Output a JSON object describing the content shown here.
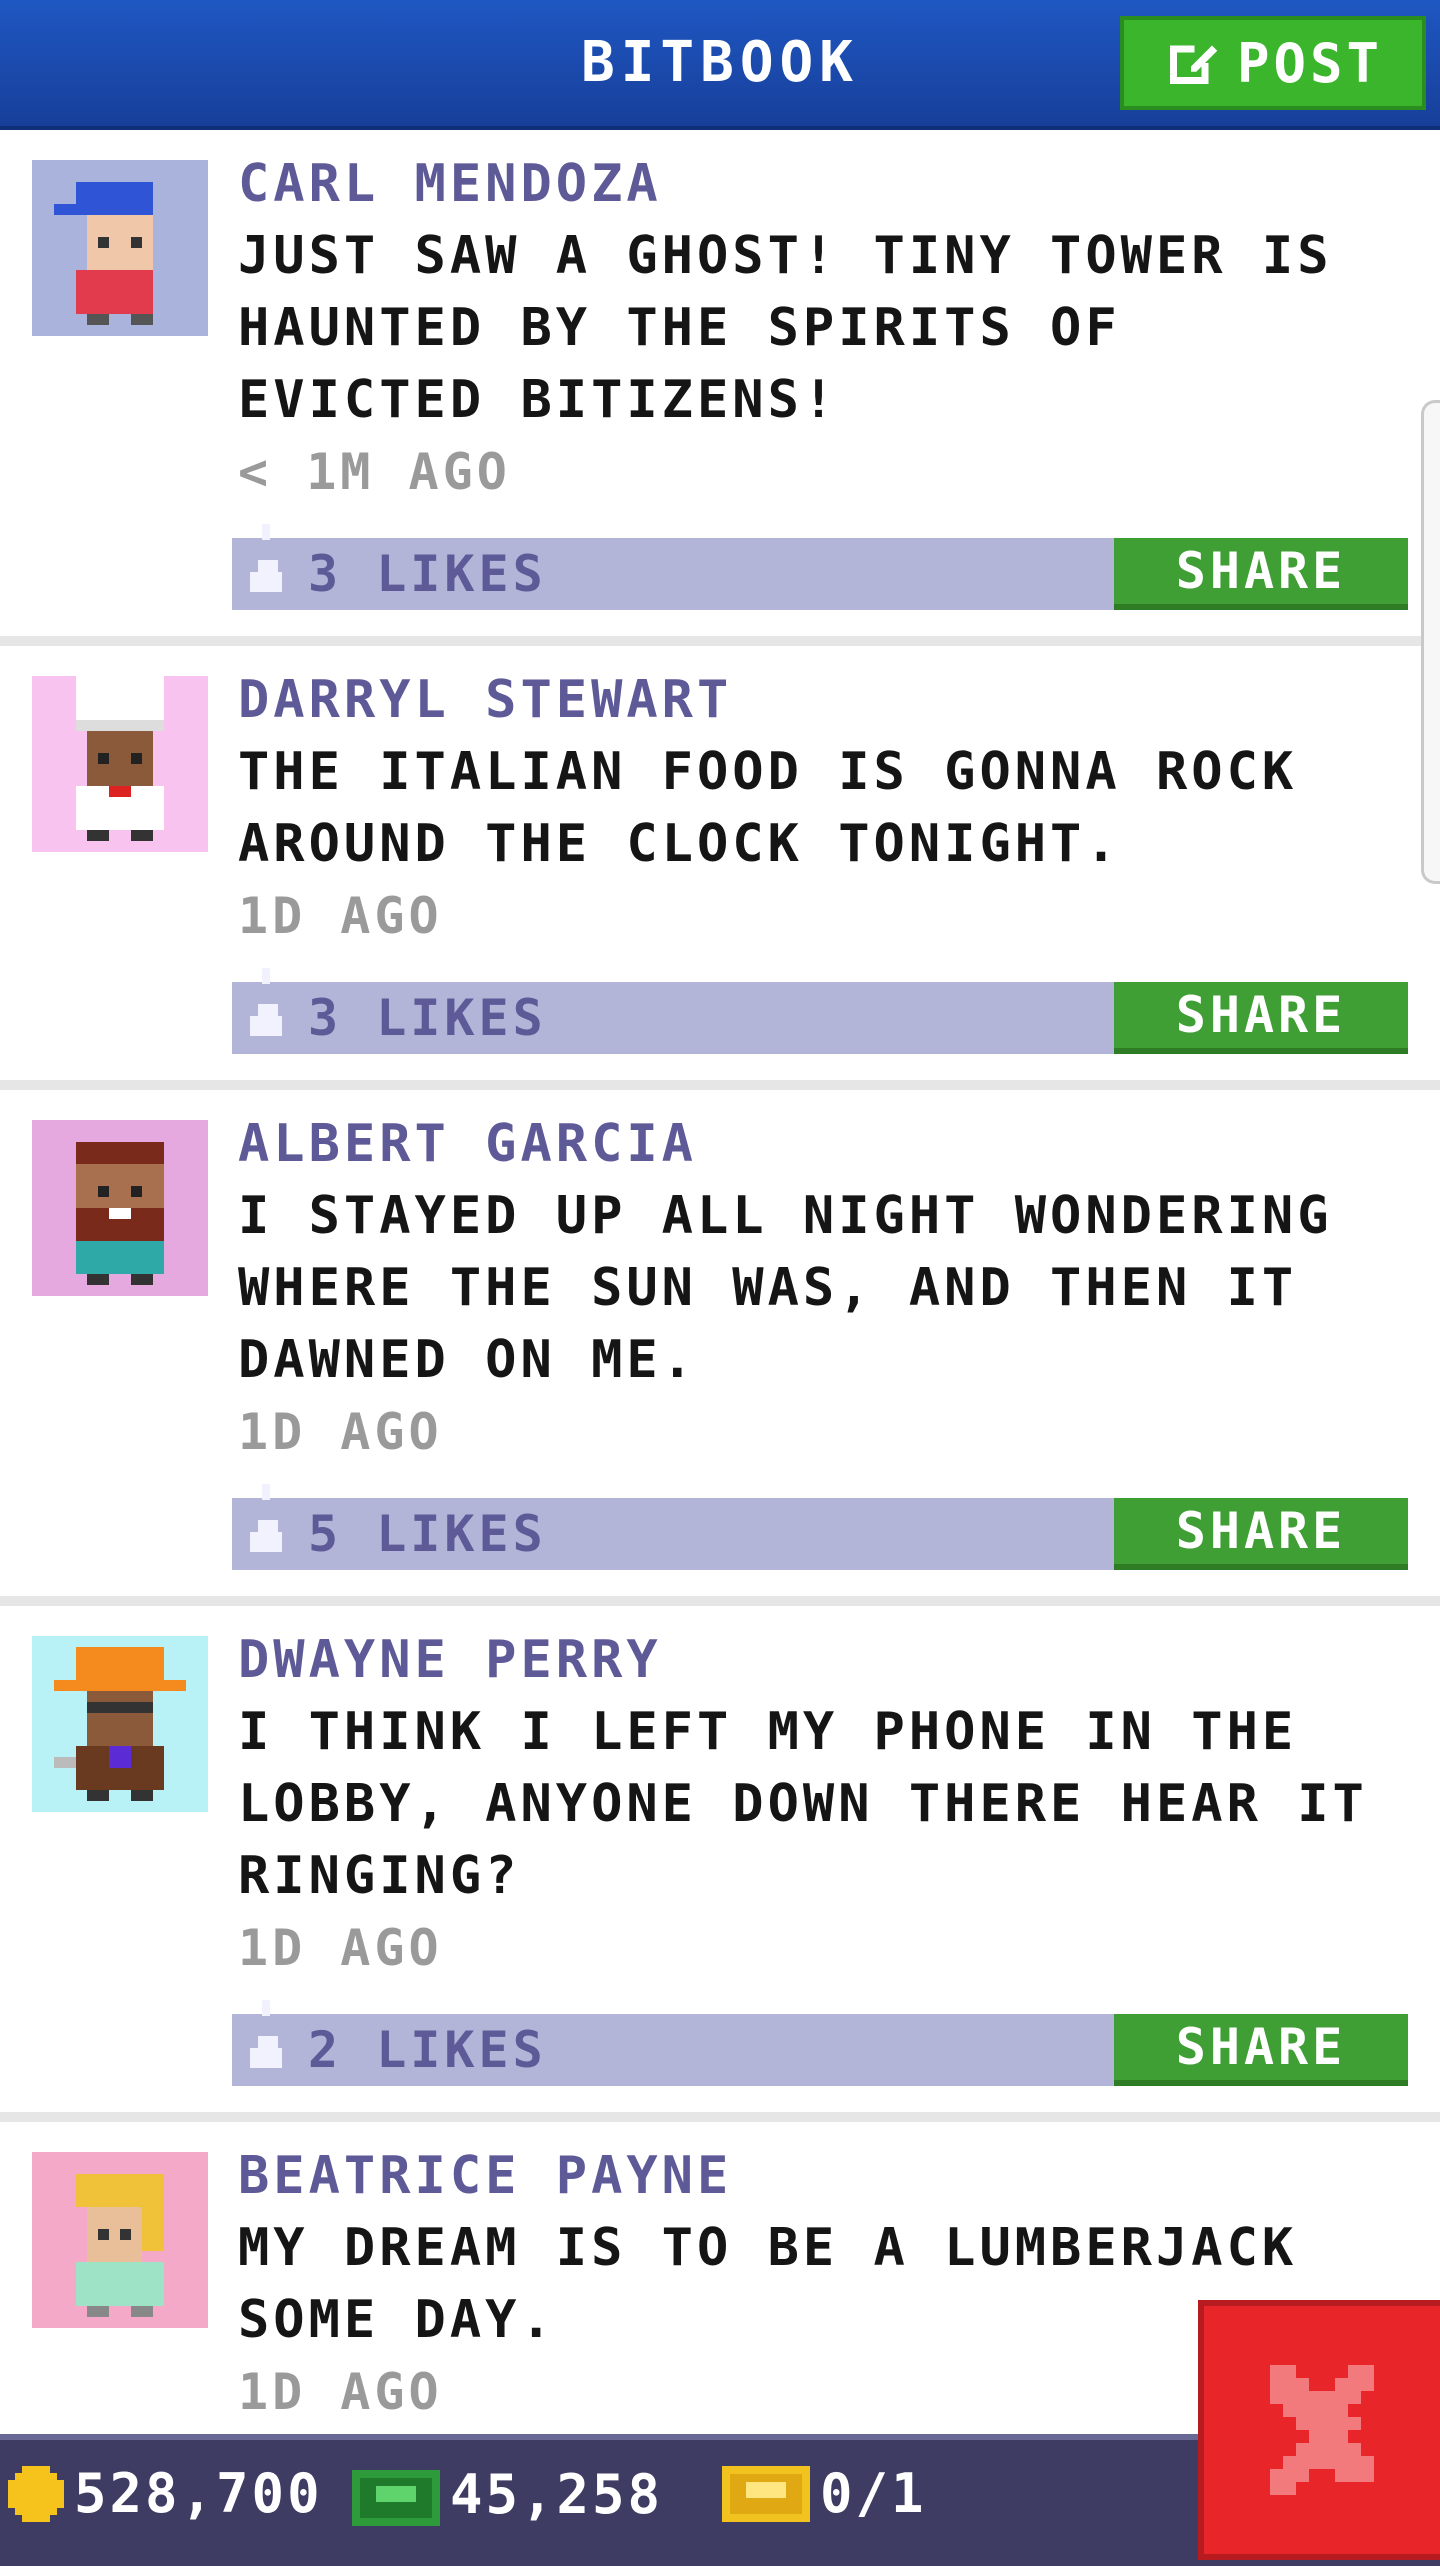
{
  "header": {
    "title": "BITBOOK",
    "post_label": "POST"
  },
  "feed": {
    "share_label": "SHARE",
    "posts": [
      {
        "author": "CARL MENDOZA",
        "message": "JUST SAW A GHOST! TINY TOWER IS HAUNTED BY THE SPIRITS OF EVICTED BITIZENS!",
        "time": "< 1M AGO",
        "likes": "3 LIKES",
        "avatar_bg": "#aab3db",
        "avatar_type": "cap"
      },
      {
        "author": "DARRYL STEWART",
        "message": "THE ITALIAN FOOD IS GONNA ROCK AROUND THE CLOCK TONIGHT.",
        "time": "1D AGO",
        "likes": "3 LIKES",
        "avatar_bg": "#f9c3ef",
        "avatar_type": "chef"
      },
      {
        "author": "ALBERT GARCIA",
        "message": "I STAYED UP ALL NIGHT WONDERING WHERE THE SUN WAS, AND THEN IT DAWNED ON ME.",
        "time": "1D AGO",
        "likes": "5 LIKES",
        "avatar_bg": "#e5a9e0",
        "avatar_type": "beard"
      },
      {
        "author": "DWAYNE PERRY",
        "message": "I THINK I LEFT MY PHONE IN THE LOBBY, ANYONE DOWN THERE HEAR IT RINGING?",
        "time": "1D AGO",
        "likes": "2 LIKES",
        "avatar_bg": "#b9f2f6",
        "avatar_type": "hardhat"
      },
      {
        "author": "BEATRICE PAYNE",
        "message": "MY DREAM IS TO BE A LUMBERJACK SOME DAY.",
        "time": "1D AGO",
        "likes": "",
        "avatar_bg": "#f5a9c9",
        "avatar_type": "blonde"
      }
    ]
  },
  "currency": {
    "coins": "528,700",
    "bux": "45,258",
    "tickets": "0/1"
  },
  "colors": {
    "header": "#1f57c2",
    "accent_green": "#3f9e34",
    "like_bar": "#b3b5d8",
    "author": "#5d5a97",
    "close_red": "#e8262a"
  },
  "icons": [
    "post-edit-icon",
    "thumbs-up-icon",
    "coin-icon",
    "bux-icon",
    "ticket-icon",
    "close-icon"
  ]
}
